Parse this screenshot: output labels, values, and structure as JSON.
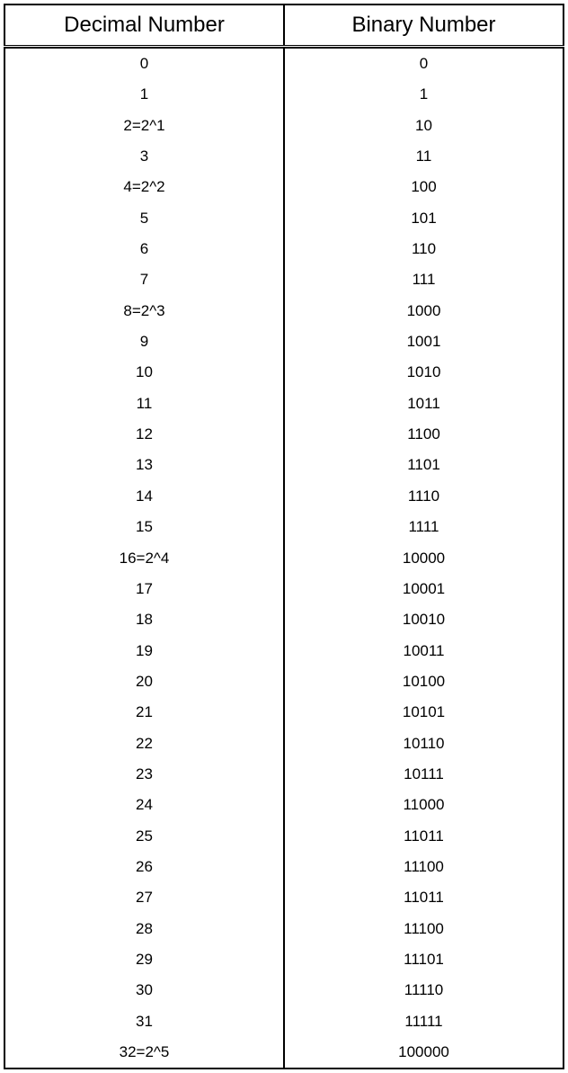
{
  "chart_data": {
    "type": "table",
    "headers": [
      "Decimal Number",
      "Binary Number"
    ],
    "rows": [
      {
        "decimal": "0",
        "binary": "0"
      },
      {
        "decimal": "1",
        "binary": "1"
      },
      {
        "decimal": "2=2^1",
        "binary": "10"
      },
      {
        "decimal": "3",
        "binary": "11"
      },
      {
        "decimal": "4=2^2",
        "binary": "100"
      },
      {
        "decimal": "5",
        "binary": "101"
      },
      {
        "decimal": "6",
        "binary": "110"
      },
      {
        "decimal": "7",
        "binary": "111"
      },
      {
        "decimal": "8=2^3",
        "binary": "1000"
      },
      {
        "decimal": "9",
        "binary": "1001"
      },
      {
        "decimal": "10",
        "binary": "1010"
      },
      {
        "decimal": "11",
        "binary": "1011"
      },
      {
        "decimal": "12",
        "binary": "1100"
      },
      {
        "decimal": "13",
        "binary": "1101"
      },
      {
        "decimal": "14",
        "binary": "1110"
      },
      {
        "decimal": "15",
        "binary": "1111"
      },
      {
        "decimal": "16=2^4",
        "binary": "10000"
      },
      {
        "decimal": "17",
        "binary": "10001"
      },
      {
        "decimal": "18",
        "binary": "10010"
      },
      {
        "decimal": "19",
        "binary": "10011"
      },
      {
        "decimal": "20",
        "binary": "10100"
      },
      {
        "decimal": "21",
        "binary": "10101"
      },
      {
        "decimal": "22",
        "binary": "10110"
      },
      {
        "decimal": "23",
        "binary": "10111"
      },
      {
        "decimal": "24",
        "binary": "11000"
      },
      {
        "decimal": "25",
        "binary": "11011"
      },
      {
        "decimal": "26",
        "binary": "11100"
      },
      {
        "decimal": "27",
        "binary": "11011"
      },
      {
        "decimal": "28",
        "binary": "11100"
      },
      {
        "decimal": "29",
        "binary": "11101"
      },
      {
        "decimal": "30",
        "binary": "11110"
      },
      {
        "decimal": "31",
        "binary": "11111"
      },
      {
        "decimal": "32=2^5",
        "binary": "100000"
      }
    ]
  }
}
